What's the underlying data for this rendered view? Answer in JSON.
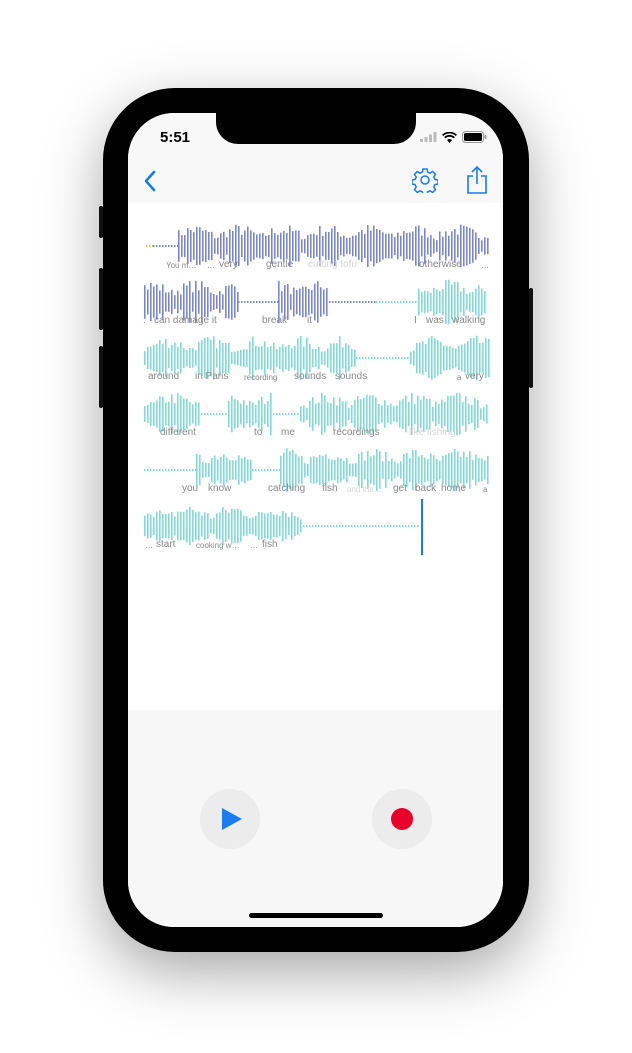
{
  "status_bar": {
    "time": "5:51",
    "icons": [
      "cellular-signal-icon",
      "wifi-icon",
      "battery-icon"
    ]
  },
  "nav": {
    "back_icon": "chevron-left-icon",
    "settings_icon": "gear-icon",
    "share_icon": "share-icon"
  },
  "colors": {
    "accent": "#1a7cf0",
    "wave_purple": "#7b86d9",
    "wave_teal": "#80dcd8",
    "wave_yellow": "#d9c25a",
    "record": "#e8002a"
  },
  "transcript": {
    "rows": [
      {
        "words": [
          {
            "text": "You m…",
            "small": true
          },
          {
            "text": "…",
            "small": true
          },
          {
            "text": "very"
          },
          {
            "text": "gentle"
          },
          {
            "text": "cutting tofu",
            "faded": true
          },
          {
            "text": "otherwise"
          },
          {
            "text": "…",
            "small": true
          }
        ]
      },
      {
        "words": [
          {
            "text": "."
          },
          {
            "text": "can damage it"
          },
          {
            "text": "break"
          },
          {
            "text": "it"
          },
          {
            "text": "I"
          },
          {
            "text": "was"
          },
          {
            "text": "walking"
          }
        ]
      },
      {
        "words": [
          {
            "text": "around"
          },
          {
            "text": "in Paris"
          },
          {
            "text": "recording",
            "small": true
          },
          {
            "text": "sounds"
          },
          {
            "text": "sounds"
          },
          {
            "text": "a",
            "small": true
          },
          {
            "text": "very"
          }
        ]
      },
      {
        "words": [
          {
            "text": "different"
          },
          {
            "text": "to"
          },
          {
            "text": "me"
          },
          {
            "text": "recordings"
          },
          {
            "text": "like fishing",
            "faded": true
          }
        ]
      },
      {
        "words": [
          {
            "text": "you"
          },
          {
            "text": "know"
          },
          {
            "text": "catching"
          },
          {
            "text": "fish"
          },
          {
            "text": "and the…",
            "small": true,
            "faded": true
          },
          {
            "text": "get"
          },
          {
            "text": "back"
          },
          {
            "text": "home"
          },
          {
            "text": "a",
            "small": true
          }
        ]
      },
      {
        "words": [
          {
            "text": "…",
            "small": true
          },
          {
            "text": "start"
          },
          {
            "text": "cooking w…",
            "small": true
          },
          {
            "text": "…",
            "small": true
          },
          {
            "text": "fish"
          }
        ]
      }
    ]
  },
  "controls": {
    "play_icon": "play-icon",
    "record_icon": "record-icon"
  }
}
